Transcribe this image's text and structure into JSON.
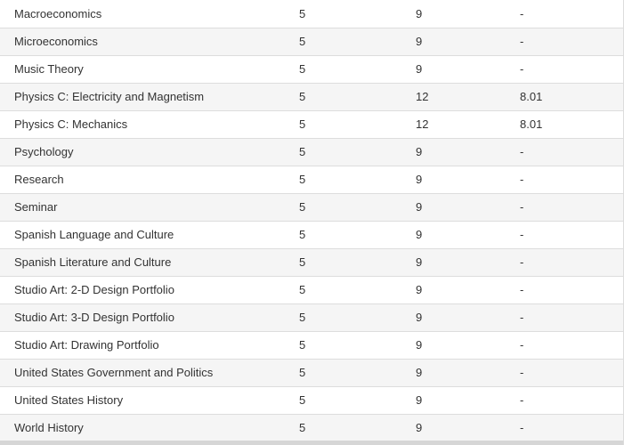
{
  "table": {
    "rows": [
      {
        "course": "Macroeconomics",
        "score": "5",
        "units": "9",
        "equivalent": "-"
      },
      {
        "course": "Microeconomics",
        "score": "5",
        "units": "9",
        "equivalent": "-"
      },
      {
        "course": "Music Theory",
        "score": "5",
        "units": "9",
        "equivalent": "-"
      },
      {
        "course": "Physics C: Electricity and Magnetism",
        "score": "5",
        "units": "12",
        "equivalent": "8.01"
      },
      {
        "course": "Physics C: Mechanics",
        "score": "5",
        "units": "12",
        "equivalent": "8.01"
      },
      {
        "course": "Psychology",
        "score": "5",
        "units": "9",
        "equivalent": "-"
      },
      {
        "course": "Research",
        "score": "5",
        "units": "9",
        "equivalent": "-"
      },
      {
        "course": "Seminar",
        "score": "5",
        "units": "9",
        "equivalent": "-"
      },
      {
        "course": "Spanish Language and Culture",
        "score": "5",
        "units": "9",
        "equivalent": "-"
      },
      {
        "course": "Spanish Literature and Culture",
        "score": "5",
        "units": "9",
        "equivalent": "-"
      },
      {
        "course": "Studio Art: 2-D Design Portfolio",
        "score": "5",
        "units": "9",
        "equivalent": "-"
      },
      {
        "course": "Studio Art: 3-D Design Portfolio",
        "score": "5",
        "units": "9",
        "equivalent": "-"
      },
      {
        "course": "Studio Art: Drawing Portfolio",
        "score": "5",
        "units": "9",
        "equivalent": "-"
      },
      {
        "course": "United States Government and Politics",
        "score": "5",
        "units": "9",
        "equivalent": "-"
      },
      {
        "course": "United States History",
        "score": "5",
        "units": "9",
        "equivalent": "-"
      },
      {
        "course": "World History",
        "score": "5",
        "units": "9",
        "equivalent": "-"
      }
    ]
  },
  "colors": {
    "row_alt": "#f5f5f5",
    "row_base": "#ffffff",
    "border": "#dddddd",
    "text": "#333333"
  }
}
